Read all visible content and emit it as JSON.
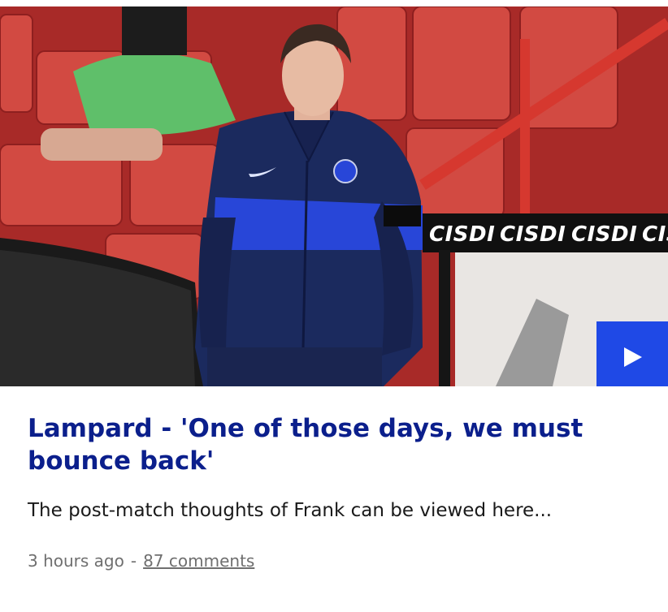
{
  "article": {
    "title": "Lampard - 'One of those days, we must bounce back'",
    "summary": "The post-match thoughts of Frank can be viewed here...",
    "time_ago": "3 hours ago",
    "separator": "-",
    "comments_link": "87 comments"
  },
  "hero": {
    "sponsor_board_text": [
      "CISDI",
      "CISDI",
      "CISDI",
      "CIS"
    ],
    "play_icon": "play-icon"
  },
  "colors": {
    "headline": "#0b1f8c",
    "play_button": "#1f49e6",
    "meta_text": "#6f6f6f",
    "seat_red": "#c9403a"
  }
}
